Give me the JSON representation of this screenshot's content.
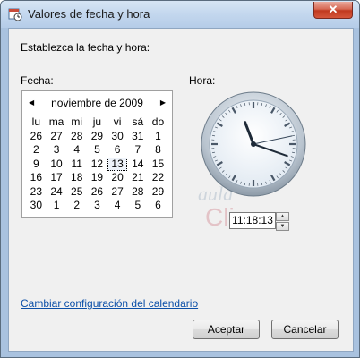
{
  "window": {
    "title": "Valores de fecha y hora",
    "close_label": "✕"
  },
  "instruction": "Establezca la fecha y hora:",
  "fecha_label": "Fecha:",
  "hora_label": "Hora:",
  "calendar": {
    "month_year": "noviembre de 2009",
    "prev_label": "◀",
    "next_label": "▶",
    "weekdays": [
      "lu",
      "ma",
      "mi",
      "ju",
      "vi",
      "sá",
      "do"
    ],
    "weeks": [
      [
        "26",
        "27",
        "28",
        "29",
        "30",
        "31",
        "1"
      ],
      [
        "2",
        "3",
        "4",
        "5",
        "6",
        "7",
        "8"
      ],
      [
        "9",
        "10",
        "11",
        "12",
        "13",
        "14",
        "15"
      ],
      [
        "16",
        "17",
        "18",
        "19",
        "20",
        "21",
        "22"
      ],
      [
        "23",
        "24",
        "25",
        "26",
        "27",
        "28",
        "29"
      ],
      [
        "30",
        "1",
        "2",
        "3",
        "4",
        "5",
        "6"
      ]
    ],
    "selected_day": "13"
  },
  "clock": {
    "hours": 11,
    "minutes": 18,
    "seconds": 13
  },
  "time_value": "11:18:13",
  "watermark": {
    "line1": "aula",
    "line2": "Clic"
  },
  "link_text": "Cambiar configuración del calendario",
  "buttons": {
    "ok": "Aceptar",
    "cancel": "Cancelar"
  },
  "colors": {
    "link": "#0b4fa8",
    "title_bar": "#c3d7ee",
    "close": "#c0391f"
  }
}
